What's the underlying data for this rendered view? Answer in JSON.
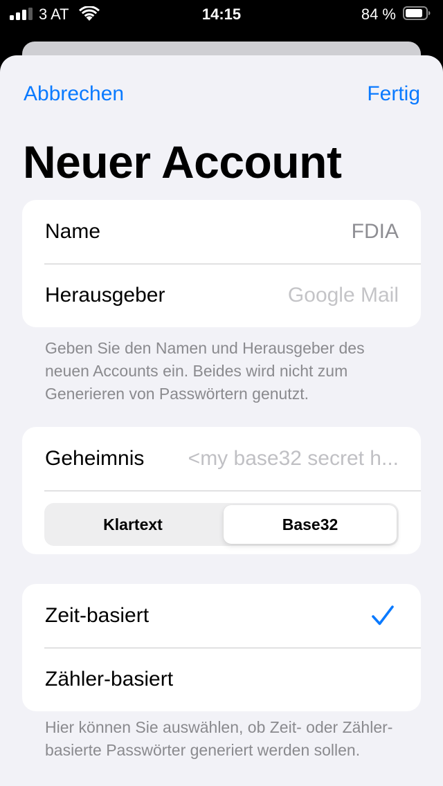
{
  "status_bar": {
    "carrier": "3 AT",
    "time": "14:15",
    "battery_percent": "84 %"
  },
  "nav": {
    "cancel_label": "Abbrechen",
    "done_label": "Fertig"
  },
  "page_title": "Neuer Account",
  "account_group": {
    "name_label": "Name",
    "name_value": "FDIA",
    "issuer_label": "Herausgeber",
    "issuer_placeholder": "Google Mail"
  },
  "account_footnote": "Geben Sie den Namen und Herausgeber des neuen Accounts ein. Beides wird nicht zum Generieren von Passwörtern genutzt.",
  "secret_group": {
    "secret_label": "Geheimnis",
    "secret_placeholder": "<my base32 secret h...",
    "segments": [
      "Klartext",
      "Base32"
    ],
    "selected_segment": "Base32"
  },
  "type_group": {
    "time_based_label": "Zeit-basiert",
    "counter_based_label": "Zähler-basiert",
    "selected": "Zeit-basiert"
  },
  "type_footnote": "Hier können Sie auswählen, ob Zeit- oder Zähler-basierte Passwörter generiert werden sollen.",
  "colors": {
    "accent": "#0a7aff",
    "background": "#f2f2f7"
  }
}
